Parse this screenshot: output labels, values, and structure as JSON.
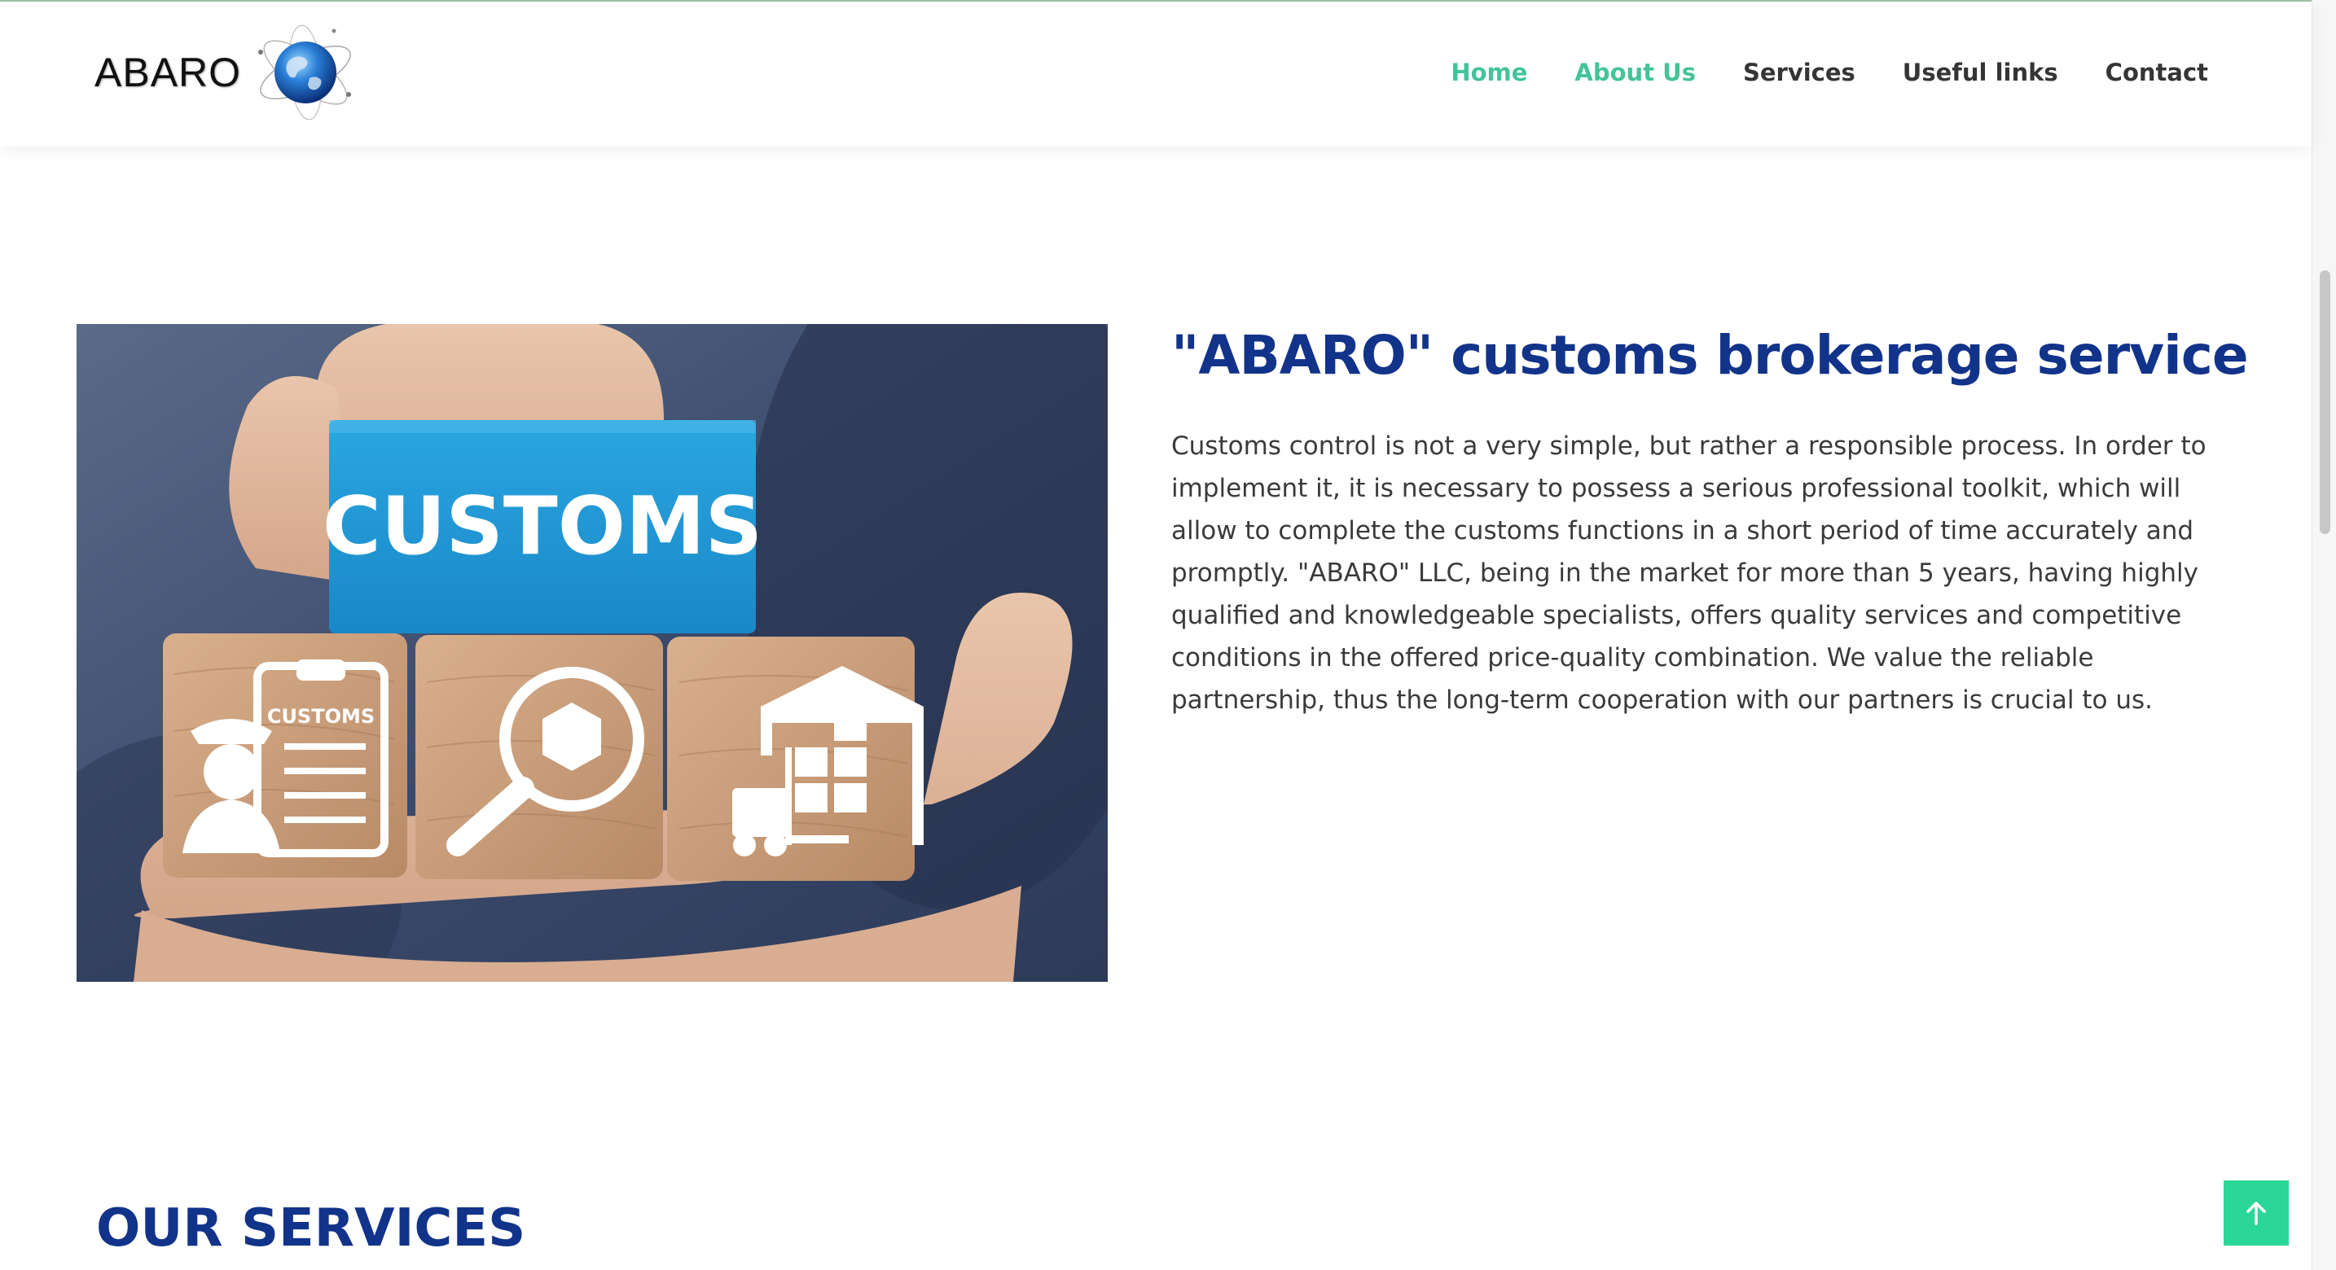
{
  "header": {
    "logo_text": "ABARO",
    "logo_icon": "globe-icon",
    "nav": [
      {
        "label": "Home",
        "active": true
      },
      {
        "label": "About Us",
        "active": true
      },
      {
        "label": "Services",
        "active": false
      },
      {
        "label": "Useful links",
        "active": false
      },
      {
        "label": "Contact",
        "active": false
      }
    ]
  },
  "hero": {
    "image_block_label": "CUSTOMS",
    "image_small_label": "CUSTOMS",
    "title": "\"ABARO\" customs brokerage service",
    "body": "Customs control is not a very simple, but rather a responsible process. In order to implement it, it is necessary to possess a serious professional toolkit, which will allow to complete the customs functions in a short period of time accurately and promptly. \"ABARO\" LLC, being in the market for more than 5 years, having highly qualified and knowledgeable specialists, offers quality services and competitive conditions in the offered price-quality combination. We value the reliable partnership, thus the long-term cooperation with our partners is crucial to us."
  },
  "services": {
    "title": "OUR SERVICES"
  },
  "back_to_top": {
    "icon": "arrow-up-icon"
  },
  "colors": {
    "accent": "#44c39b",
    "brand_blue": "#12338a",
    "back_to_top": "#2bd699",
    "customs_block": "#1f9bd8",
    "wood": "#c89a74"
  }
}
